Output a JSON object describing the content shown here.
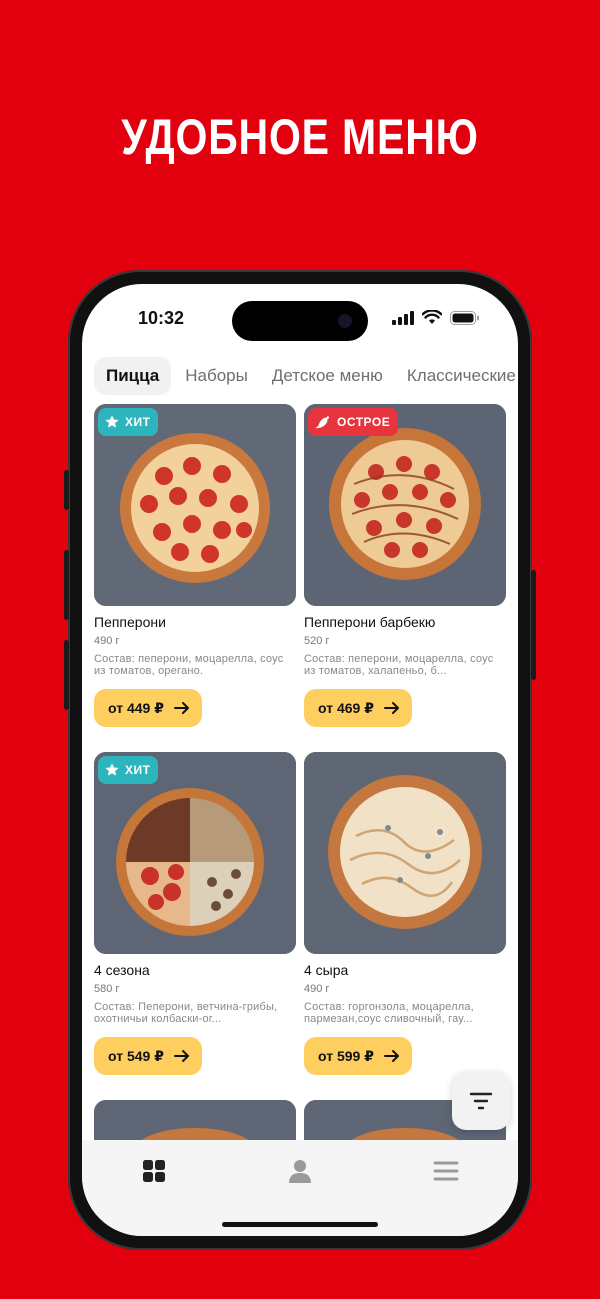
{
  "headline": "УДОБНОЕ МЕНЮ",
  "status_bar": {
    "time": "10:32"
  },
  "categories": {
    "items": [
      "Пицца",
      "Наборы",
      "Детское меню",
      "Классические р"
    ],
    "active": "Пицца"
  },
  "products": [
    {
      "name": "Пепперони",
      "weight": "490 г",
      "description": "Состав: пеперони, моцарелла, соус из томатов, орегано.",
      "price": "от 449 ₽",
      "badge": {
        "label": "ХИТ",
        "icon": "star-icon",
        "color": "#2cb5bd"
      }
    },
    {
      "name": "Пепперони барбекю",
      "weight": "520 г",
      "description": "Состав: пеперони, моцарелла, соус из томатов, халапеньо, б...",
      "price": "от 469 ₽",
      "badge": {
        "label": "ОСТРОЕ",
        "icon": "chili-pepper-icon",
        "color": "#e8343d"
      }
    },
    {
      "name": "4 сезона",
      "weight": "580 г",
      "description": "Состав: Пеперони, ветчина-грибы, охотничьи колбаски-ог...",
      "price": "от 549 ₽",
      "badge": {
        "label": "ХИТ",
        "icon": "star-icon",
        "color": "#2cb5bd"
      }
    },
    {
      "name": "4 сыра",
      "weight": "490 г",
      "description": "Состав: горгонзола, моцарелла, пармезан,соус сливочный, гау...",
      "price": "от 599 ₽",
      "badge": null
    }
  ],
  "tab_bar": {
    "items": [
      "grid-icon",
      "profile-icon",
      "menu-icon"
    ]
  },
  "colors": {
    "background": "#e2000f",
    "price_button": "#fece5e",
    "hit_badge": "#2cb5bd",
    "spicy_badge": "#e8343d"
  }
}
